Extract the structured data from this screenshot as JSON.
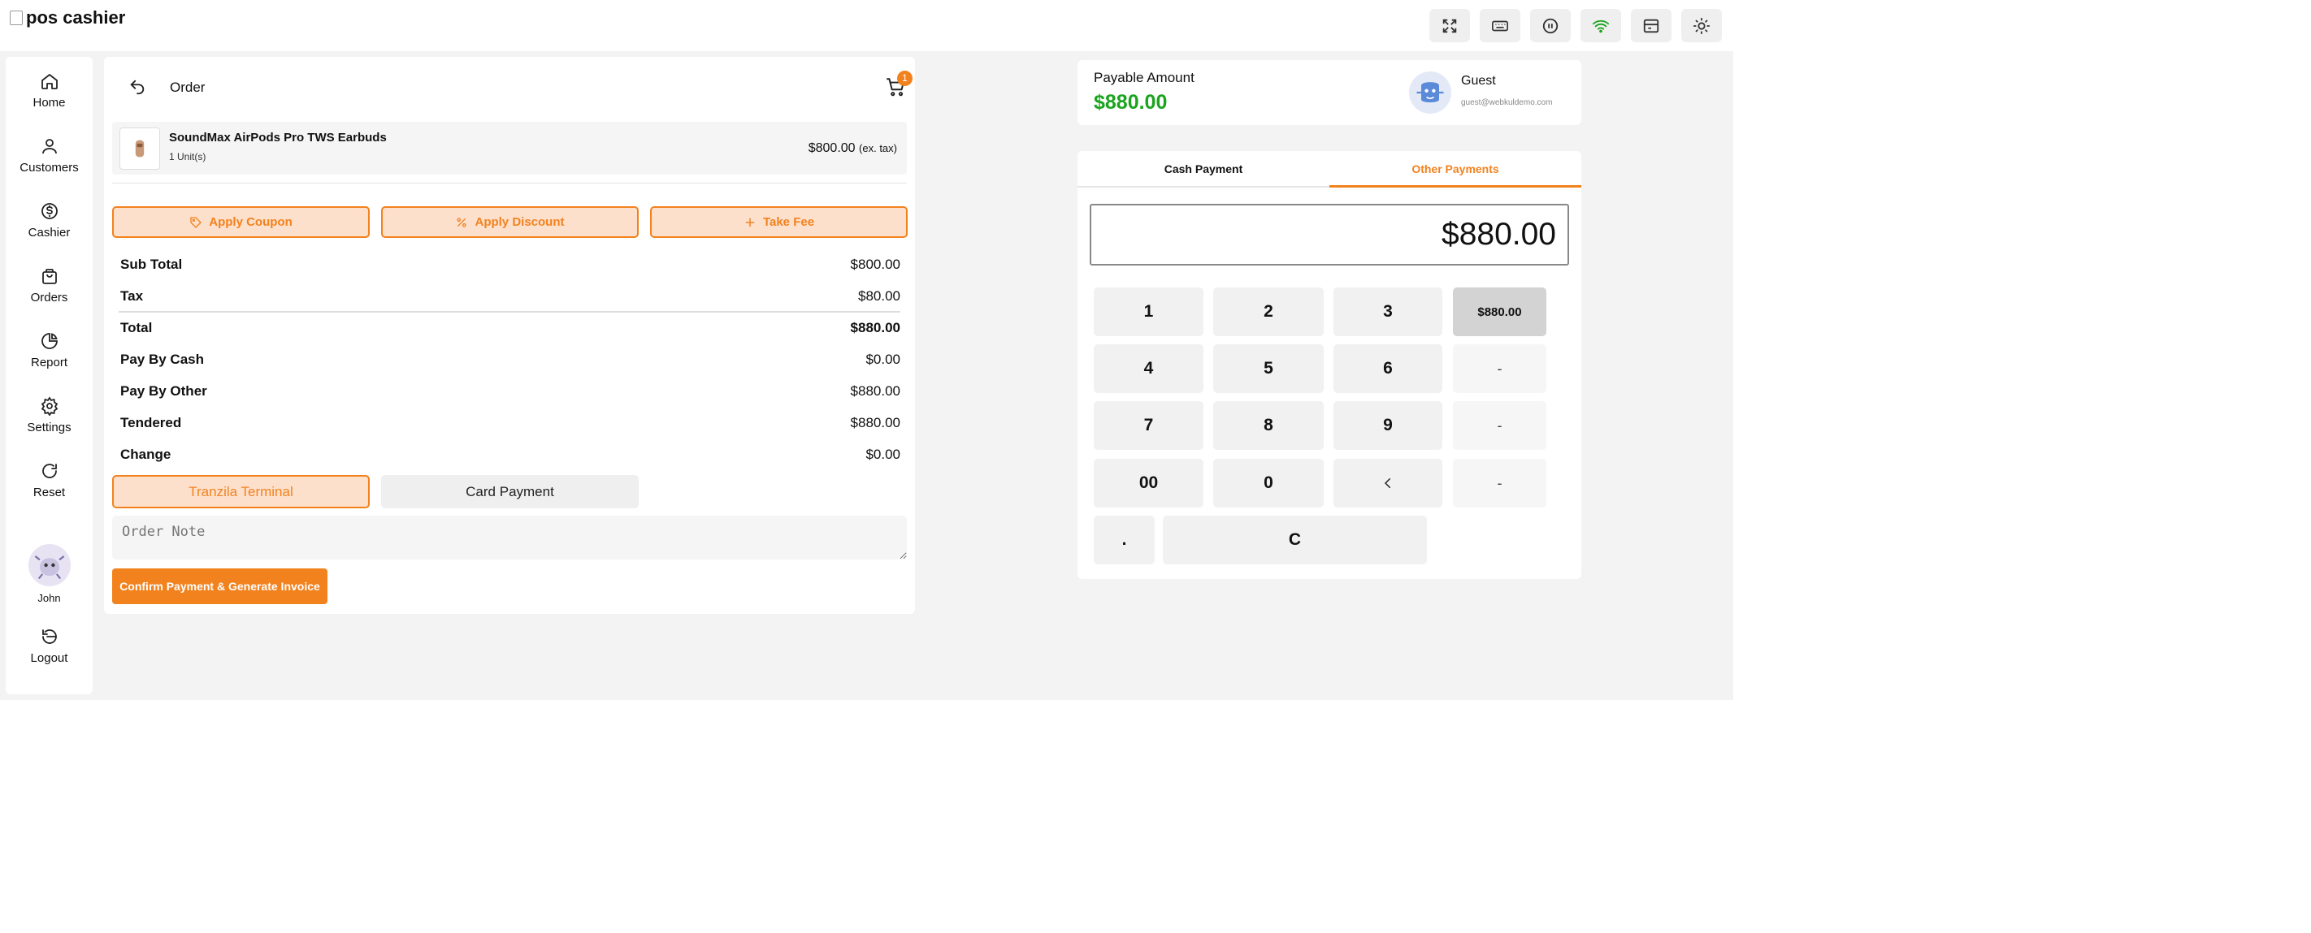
{
  "header": {
    "logo_alt": "pos cashier",
    "icons": [
      "fullscreen-icon",
      "keyboard-icon",
      "pause-icon",
      "wifi-icon",
      "register-icon",
      "theme-sun-icon"
    ],
    "wifi_color": "#1aa41e"
  },
  "sidebar": {
    "items": [
      {
        "label": "Home",
        "icon": "home-icon"
      },
      {
        "label": "Customers",
        "icon": "user-icon"
      },
      {
        "label": "Cashier",
        "icon": "dollar-icon"
      },
      {
        "label": "Orders",
        "icon": "bag-icon"
      },
      {
        "label": "Report",
        "icon": "pie-chart-icon"
      },
      {
        "label": "Settings",
        "icon": "gear-icon"
      },
      {
        "label": "Reset",
        "icon": "refresh-icon"
      }
    ],
    "user_name": "John",
    "logout_label": "Logout"
  },
  "order": {
    "title": "Order",
    "cart_count": "1",
    "item": {
      "name": "SoundMax AirPods Pro TWS Earbuds",
      "units": "1 Unit(s)",
      "price": "$800.00",
      "price_note": "(ex. tax)"
    },
    "actions": {
      "coupon": "Apply Coupon",
      "discount": "Apply Discount",
      "fee": "Take Fee"
    },
    "summary": [
      {
        "label": "Sub Total",
        "value": "$800.00"
      },
      {
        "label": "Tax",
        "value": "$80.00"
      },
      {
        "label": "Total",
        "value": "$880.00"
      },
      {
        "label": "Pay By Cash",
        "value": "$0.00"
      },
      {
        "label": "Pay By Other",
        "value": "$880.00"
      },
      {
        "label": "Tendered",
        "value": "$880.00"
      },
      {
        "label": "Change",
        "value": "$0.00"
      }
    ],
    "payment_methods": {
      "active": "Tranzila Terminal",
      "inactive": "Card Payment"
    },
    "note_placeholder": "Order Note",
    "confirm_label": "Confirm Payment & Generate Invoice"
  },
  "payment": {
    "payable_label": "Payable Amount",
    "payable_amount": "$880.00",
    "guest_name": "Guest",
    "guest_email": "guest@webkuldemo.com",
    "tabs": {
      "cash": "Cash Payment",
      "other": "Other Payments"
    },
    "amount_display": "$880.00",
    "keys": {
      "k1": "1",
      "k2": "2",
      "k3": "3",
      "quick": "$880.00",
      "k4": "4",
      "k5": "5",
      "k6": "6",
      "d1": "-",
      "k7": "7",
      "k8": "8",
      "k9": "9",
      "d2": "-",
      "k00": "00",
      "k0": "0",
      "d3": "-",
      "dot": ".",
      "clear": "C"
    }
  },
  "accent_color": "#f2821e"
}
